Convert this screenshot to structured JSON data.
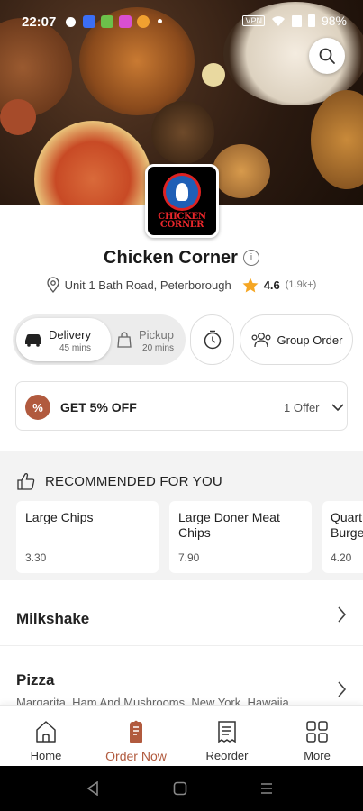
{
  "status": {
    "time": "22:07",
    "battery": "98%",
    "vpn": "VPN"
  },
  "restaurant": {
    "name": "Chicken Corner",
    "logo_text": "CHICKEN CORNER",
    "address": "Unit 1 Bath Road, Peterborough",
    "rating": "4.6",
    "rating_count": "(1.9k+)"
  },
  "order_type": {
    "delivery": {
      "label": "Delivery",
      "time": "45 mins"
    },
    "pickup": {
      "label": "Pickup",
      "time": "20 mins"
    },
    "group_order": "Group Order"
  },
  "offer": {
    "text": "GET 5% OFF",
    "count": "1 Offer",
    "badge": "%"
  },
  "recommended": {
    "title": "RECOMMENDED FOR YOU",
    "items": [
      {
        "name": "Large Chips",
        "price": "3.30"
      },
      {
        "name": "Large Doner Meat Chips",
        "price": "7.90"
      },
      {
        "name": "Quart Burge",
        "price": "4.20"
      }
    ]
  },
  "categories": [
    {
      "name": "Milkshake",
      "desc": ""
    },
    {
      "name": "Pizza",
      "desc": "Margarita, Ham And Mushrooms, New York, Hawaiia"
    }
  ],
  "nav": [
    {
      "label": "Home",
      "icon": "home-icon"
    },
    {
      "label": "Order Now",
      "icon": "order-bag-icon"
    },
    {
      "label": "Reorder",
      "icon": "receipt-icon"
    },
    {
      "label": "More",
      "icon": "grid-icon"
    }
  ],
  "colors": {
    "accent": "#b15a3e",
    "star": "#f5a623"
  }
}
